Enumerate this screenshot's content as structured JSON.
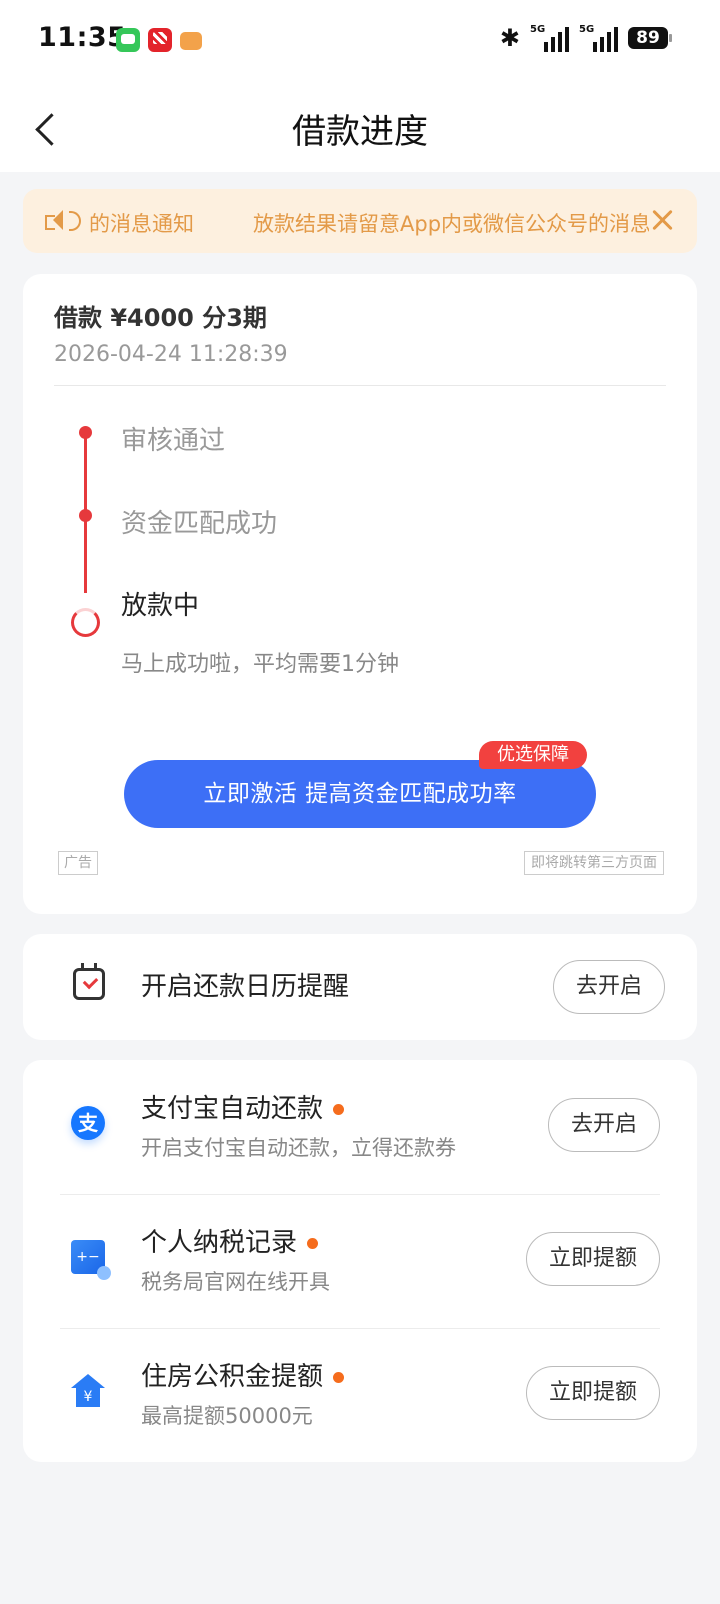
{
  "status_bar": {
    "time": "11:35",
    "battery": "89",
    "network_1": "5G",
    "network_2": "5G"
  },
  "header": {
    "title": "借款进度"
  },
  "notice": {
    "text_left": "的消息通知",
    "text_right": "放款结果请留意App内或微信公众号的消息通知"
  },
  "loan": {
    "summary": "借款 ¥4000  分3期",
    "time": "2026-04-24 11:28:39",
    "steps": [
      {
        "label": "审核通过",
        "state": "done"
      },
      {
        "label": "资金匹配成功",
        "state": "done"
      },
      {
        "label": "放款中",
        "state": "in-progress",
        "sub": "马上成功啦，平均需要1分钟"
      }
    ]
  },
  "ad": {
    "cta": "立即激活 提高资金匹配成功率",
    "badge": "优选保障",
    "tag": "广告",
    "jump_notice": "即将跳转第三方页面"
  },
  "calendar": {
    "label": "开启还款日历提醒",
    "button": "去开启"
  },
  "services": [
    {
      "title": "支付宝自动还款",
      "desc": "开启支付宝自动还款，立得还款券",
      "button": "去开启",
      "icon": "alipay-icon",
      "icon_glyph": "支"
    },
    {
      "title": "个人纳税记录",
      "desc": "税务局官网在线开具",
      "button": "立即提额",
      "icon": "tax-record-icon",
      "icon_glyph": "+−"
    },
    {
      "title": "住房公积金提额",
      "desc": "最高提额50000元",
      "button": "立即提额",
      "icon": "housing-fund-icon"
    }
  ],
  "colors": {
    "primary": "#3d6ff6",
    "accent_red": "#e6393c",
    "notice_bg": "#fdf0df",
    "notice_text": "#e39a48",
    "dot_orange": "#f56c1d"
  }
}
